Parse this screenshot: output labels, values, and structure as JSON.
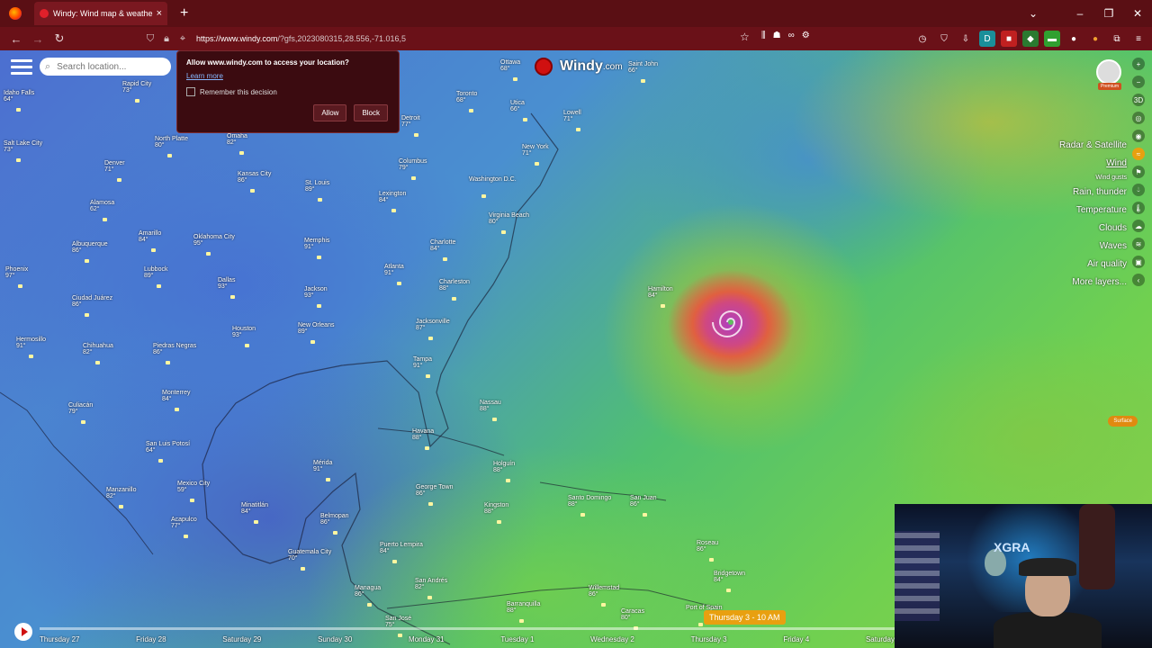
{
  "browser": {
    "tab_title": "Windy: Wind map & weather fo",
    "url_host": "https://www.windy.com",
    "url_path": "/?gfs,2023080315,28.556,-71.016,5"
  },
  "search": {
    "placeholder": "Search location..."
  },
  "permission": {
    "question": "Allow www.windy.com to access your location?",
    "learn_more": "Learn more",
    "remember": "Remember this decision",
    "allow": "Allow",
    "block": "Block"
  },
  "logo": {
    "name": "Windy",
    "suffix": ".com"
  },
  "premium_label": "Premium",
  "layers": [
    {
      "label": "Radar & Satellite"
    },
    {
      "label": "Wind",
      "active": true
    },
    {
      "label": "Wind gusts",
      "sub": true
    },
    {
      "label": "Rain, thunder"
    },
    {
      "label": "Temperature"
    },
    {
      "label": "Clouds"
    },
    {
      "label": "Waves"
    },
    {
      "label": "Air quality"
    },
    {
      "label": "More layers..."
    }
  ],
  "surface_label": "Surface",
  "time_pill": "Thursday 3 - 10 AM",
  "timeline_days": [
    "Thursday 27",
    "Friday 28",
    "Saturday 29",
    "Sunday 30",
    "Monday 31",
    "Tuesday 1",
    "Wednesday 2",
    "Thursday 3",
    "Friday 4",
    "Saturday"
  ],
  "cities": [
    {
      "name": "Ottawa",
      "temp": "68°"
    },
    {
      "name": "Saint John",
      "temp": "66°"
    },
    {
      "name": "Toronto",
      "temp": "68°"
    },
    {
      "name": "Utica",
      "temp": "66°"
    },
    {
      "name": "Lowell",
      "temp": "71°"
    },
    {
      "name": "Detroit",
      "temp": "77°"
    },
    {
      "name": "New York",
      "temp": "71°"
    },
    {
      "name": "Columbus",
      "temp": "79°"
    },
    {
      "name": "Washington D.C.",
      "temp": ""
    },
    {
      "name": "Virginia Beach",
      "temp": "80°"
    },
    {
      "name": "Lexington",
      "temp": "84°"
    },
    {
      "name": "Charlotte",
      "temp": "84°"
    },
    {
      "name": "Atlanta",
      "temp": "91°"
    },
    {
      "name": "Charleston",
      "temp": "88°"
    },
    {
      "name": "Jacksonville",
      "temp": "87°"
    },
    {
      "name": "Tampa",
      "temp": "91°"
    },
    {
      "name": "Nassau",
      "temp": "88°"
    },
    {
      "name": "Havana",
      "temp": "88°"
    },
    {
      "name": "Hamilton",
      "temp": "84°"
    },
    {
      "name": "Holguín",
      "temp": "88°"
    },
    {
      "name": "George Town",
      "temp": "86°"
    },
    {
      "name": "Kingston",
      "temp": "88°"
    },
    {
      "name": "Santo Domingo",
      "temp": "88°"
    },
    {
      "name": "San Juan",
      "temp": "86°"
    },
    {
      "name": "Mérida",
      "temp": "91°"
    },
    {
      "name": "Belmopan",
      "temp": "86°"
    },
    {
      "name": "Guatemala City",
      "temp": "70°"
    },
    {
      "name": "Puerto Lempira",
      "temp": "84°"
    },
    {
      "name": "San Andrés",
      "temp": "82°"
    },
    {
      "name": "Managua",
      "temp": "86°"
    },
    {
      "name": "Barranquilla",
      "temp": "88°"
    },
    {
      "name": "Willemstad",
      "temp": "86°"
    },
    {
      "name": "Roseau",
      "temp": "86°"
    },
    {
      "name": "Bridgetown",
      "temp": "84°"
    },
    {
      "name": "Caracas",
      "temp": "80°"
    },
    {
      "name": "Port of Spain",
      "temp": ""
    },
    {
      "name": "San José",
      "temp": "75°"
    },
    {
      "name": "Jackson",
      "temp": "93°"
    },
    {
      "name": "New Orleans",
      "temp": "89°"
    },
    {
      "name": "Houston",
      "temp": "93°"
    },
    {
      "name": "Memphis",
      "temp": "91°"
    },
    {
      "name": "Kansas City",
      "temp": "86°"
    },
    {
      "name": "St. Louis",
      "temp": "89°"
    },
    {
      "name": "Omaha",
      "temp": "82°"
    },
    {
      "name": "Oklahoma City",
      "temp": "95°"
    },
    {
      "name": "Dallas",
      "temp": "93°"
    },
    {
      "name": "Lubbock",
      "temp": "89°"
    },
    {
      "name": "Amarillo",
      "temp": "84°"
    },
    {
      "name": "Albuquerque",
      "temp": "86°"
    },
    {
      "name": "Alamosa",
      "temp": "62°"
    },
    {
      "name": "Denver",
      "temp": "71°"
    },
    {
      "name": "North Platte",
      "temp": "80°"
    },
    {
      "name": "Rapid City",
      "temp": "73°"
    },
    {
      "name": "Phoenix",
      "temp": "97°"
    },
    {
      "name": "Ciudad Juárez",
      "temp": "86°"
    },
    {
      "name": "Chihuahua",
      "temp": "82°"
    },
    {
      "name": "Hermosillo",
      "temp": "91°"
    },
    {
      "name": "Piedras Negras",
      "temp": "86°"
    },
    {
      "name": "Monterrey",
      "temp": "84°"
    },
    {
      "name": "Culiacán",
      "temp": "79°"
    },
    {
      "name": "San Luis Potosí",
      "temp": "64°"
    },
    {
      "name": "Mexico City",
      "temp": "59°"
    },
    {
      "name": "Manzanillo",
      "temp": "82°"
    },
    {
      "name": "Acapulco",
      "temp": "77°"
    },
    {
      "name": "Minatitlán",
      "temp": "84°"
    },
    {
      "name": "Salt Lake City",
      "temp": "73°"
    },
    {
      "name": "Idaho Falls",
      "temp": "64°"
    }
  ]
}
